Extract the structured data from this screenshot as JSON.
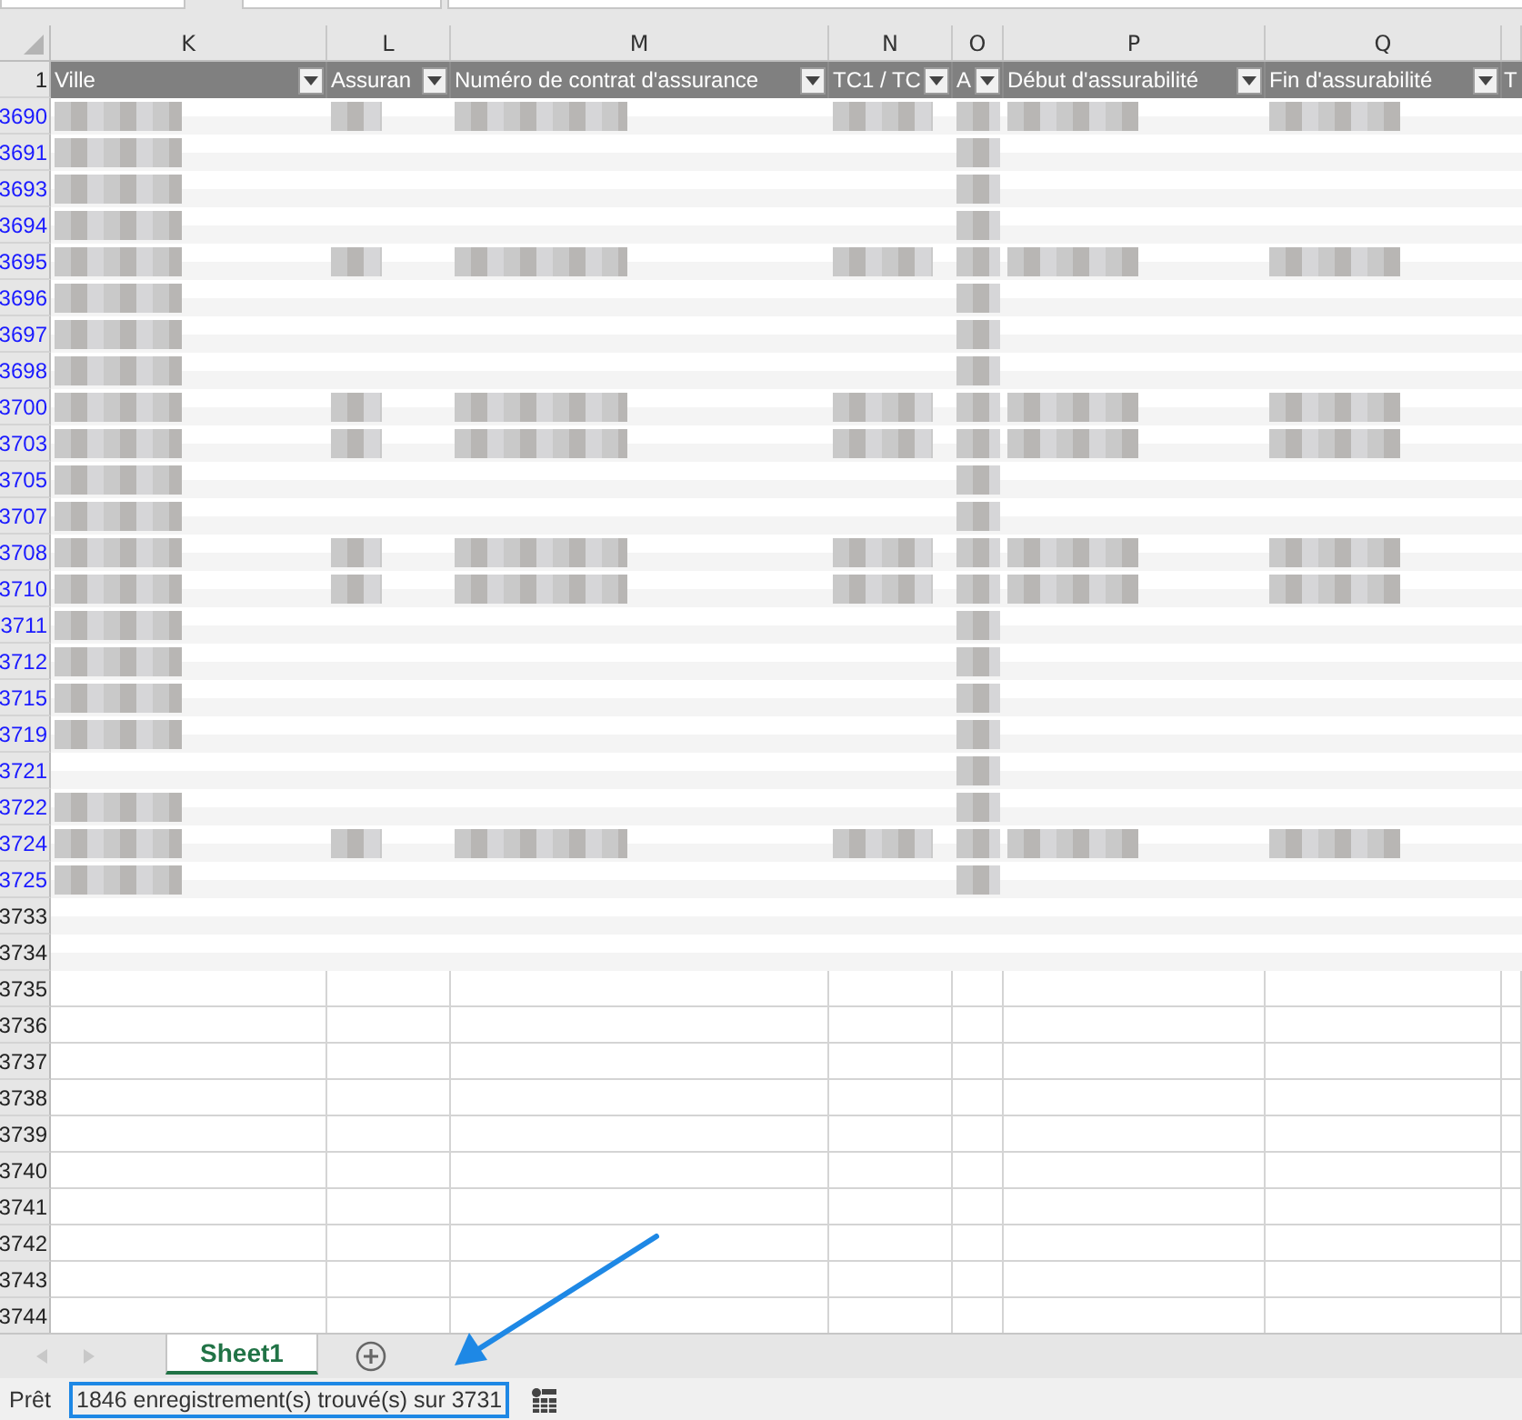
{
  "columns": [
    {
      "letter": "K",
      "header": "Ville",
      "filter": true
    },
    {
      "letter": "L",
      "header": "Assuran",
      "filter": true
    },
    {
      "letter": "M",
      "header": "Numéro de contrat d'assurance",
      "filter": true
    },
    {
      "letter": "N",
      "header": "TC1 / TC",
      "filter": true
    },
    {
      "letter": "O",
      "header": "A",
      "filter": true
    },
    {
      "letter": "P",
      "header": "Début d'assurabilité",
      "filter": true
    },
    {
      "letter": "Q",
      "header": "Fin d'assurabilité",
      "filter": true
    },
    {
      "header": "T",
      "filter": false
    }
  ],
  "header_row": "1",
  "table_rows": [
    {
      "number": "3690",
      "filtered": true,
      "kind": "full"
    },
    {
      "number": "3691",
      "filtered": true,
      "kind": "partial"
    },
    {
      "number": "3693",
      "filtered": true,
      "kind": "partial"
    },
    {
      "number": "3694",
      "filtered": true,
      "kind": "partial"
    },
    {
      "number": "3695",
      "filtered": true,
      "kind": "full"
    },
    {
      "number": "3696",
      "filtered": true,
      "kind": "partial"
    },
    {
      "number": "3697",
      "filtered": true,
      "kind": "partial"
    },
    {
      "number": "3698",
      "filtered": true,
      "kind": "partial"
    },
    {
      "number": "3700",
      "filtered": true,
      "kind": "full"
    },
    {
      "number": "3703",
      "filtered": true,
      "kind": "full"
    },
    {
      "number": "3705",
      "filtered": true,
      "kind": "partial"
    },
    {
      "number": "3707",
      "filtered": true,
      "kind": "partial"
    },
    {
      "number": "3708",
      "filtered": true,
      "kind": "full"
    },
    {
      "number": "3710",
      "filtered": true,
      "kind": "full"
    },
    {
      "number": "3711",
      "filtered": true,
      "kind": "partial"
    },
    {
      "number": "3712",
      "filtered": true,
      "kind": "partial"
    },
    {
      "number": "3715",
      "filtered": true,
      "kind": "partial"
    },
    {
      "number": "3719",
      "filtered": true,
      "kind": "partial"
    },
    {
      "number": "3721",
      "filtered": true,
      "kind": "sparse"
    },
    {
      "number": "3722",
      "filtered": true,
      "kind": "partial"
    },
    {
      "number": "3724",
      "filtered": true,
      "kind": "full"
    },
    {
      "number": "3725",
      "filtered": true,
      "kind": "partial"
    },
    {
      "number": "3733",
      "filtered": false,
      "kind": "empty"
    },
    {
      "number": "3734",
      "filtered": false,
      "kind": "empty"
    }
  ],
  "empty_rows": [
    "3735",
    "3736",
    "3737",
    "3738",
    "3739",
    "3740",
    "3741",
    "3742",
    "3743",
    "3744"
  ],
  "sheet_tabs": [
    {
      "label": "Sheet1",
      "selected": true
    }
  ],
  "status_bar": {
    "mode": "Prêt",
    "message": "1846 enregistrement(s) trouvé(s) sur 3731"
  }
}
